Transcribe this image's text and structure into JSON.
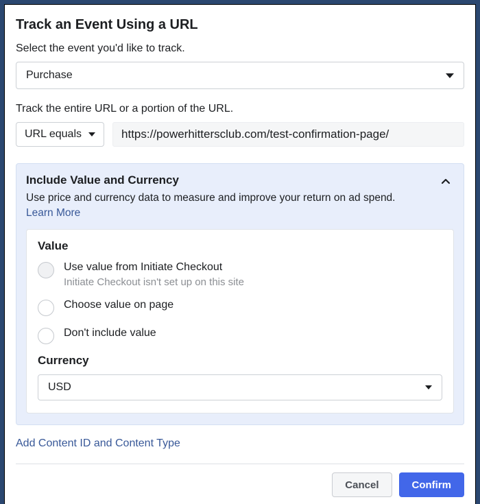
{
  "title": "Track an Event Using a URL",
  "event_select_label": "Select the event you'd like to track.",
  "event_value": "Purchase",
  "url_section_label": "Track the entire URL or a portion of the URL.",
  "url_match_value": "URL equals",
  "url_input_value": "https://powerhittersclub.com/test-confirmation-page/",
  "panel": {
    "title": "Include Value and Currency",
    "desc": "Use price and currency data to measure and improve your return on ad spend.",
    "learn_more": "Learn More",
    "value_label": "Value",
    "options": [
      {
        "label": "Use value from Initiate Checkout",
        "hint": "Initiate Checkout isn't set up on this site",
        "disabled": true
      },
      {
        "label": "Choose value on page",
        "hint": "",
        "disabled": false
      },
      {
        "label": "Don't include value",
        "hint": "",
        "disabled": false
      }
    ],
    "currency_label": "Currency",
    "currency_value": "USD"
  },
  "add_content_link": "Add Content ID and Content Type",
  "buttons": {
    "cancel": "Cancel",
    "confirm": "Confirm"
  }
}
